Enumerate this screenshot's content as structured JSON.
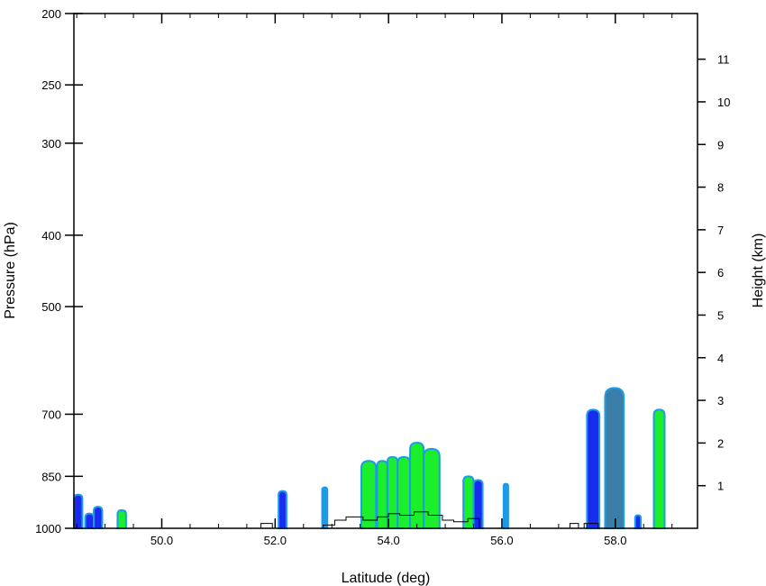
{
  "chart_data": {
    "type": "heatmap",
    "title": "",
    "xlabel": "Latitude (deg)",
    "ylabel": "Pressure (hPa)",
    "y2label": "Height (km)",
    "xlim": [
      48.45,
      59.45
    ],
    "ylim_pressure": [
      1000,
      200
    ],
    "y_scale": "log",
    "x_ticks": [
      50.0,
      52.0,
      54.0,
      56.0,
      58.0
    ],
    "x_tick_labels": [
      "50.0",
      "52.0",
      "54.0",
      "56.0",
      "58.0"
    ],
    "x_minor_step": 0.5,
    "y_ticks": [
      1000,
      850,
      700,
      500,
      400,
      300,
      250,
      200
    ],
    "y_tick_labels": [
      "1000",
      "850",
      "700",
      "500",
      "400",
      "300",
      "250",
      "200"
    ],
    "y2_ticks": [
      1,
      2,
      3,
      4,
      5,
      6,
      7,
      8,
      9,
      10,
      11
    ],
    "y2_tick_labels": [
      "1",
      "2",
      "3",
      "4",
      "5",
      "6",
      "7",
      "8",
      "9",
      "10",
      "11"
    ],
    "grid": false,
    "legend": "none",
    "contour_colors": [
      "#1e9be8",
      "#1a2bf0",
      "#1bee2a",
      "#14a83a",
      "#3a7fa8"
    ],
    "cloud_columns": [
      {
        "lat_min": 48.45,
        "lat_max": 48.6,
        "top_hpa": 900,
        "fill": "#1a2bf0"
      },
      {
        "lat_min": 48.65,
        "lat_max": 48.8,
        "top_hpa": 955,
        "fill": "#1a2bf0"
      },
      {
        "lat_min": 48.8,
        "lat_max": 48.95,
        "top_hpa": 935,
        "fill": "#1a2bf0"
      },
      {
        "lat_min": 49.22,
        "lat_max": 49.37,
        "top_hpa": 945,
        "fill": "#1bee2a"
      },
      {
        "lat_min": 52.06,
        "lat_max": 52.2,
        "top_hpa": 890,
        "fill": "#1a2bf0"
      },
      {
        "lat_min": 52.83,
        "lat_max": 52.92,
        "top_hpa": 880,
        "fill": "#1e9be8"
      },
      {
        "lat_min": 53.52,
        "lat_max": 53.78,
        "top_hpa": 810,
        "fill": "#1bee2a"
      },
      {
        "lat_min": 53.8,
        "lat_max": 53.98,
        "top_hpa": 810,
        "fill": "#1bee2a"
      },
      {
        "lat_min": 53.98,
        "lat_max": 54.16,
        "top_hpa": 800,
        "fill": "#1bee2a"
      },
      {
        "lat_min": 54.16,
        "lat_max": 54.38,
        "top_hpa": 800,
        "fill": "#1bee2a"
      },
      {
        "lat_min": 54.38,
        "lat_max": 54.62,
        "top_hpa": 765,
        "fill": "#1bee2a"
      },
      {
        "lat_min": 54.62,
        "lat_max": 54.9,
        "top_hpa": 780,
        "fill": "#1bee2a"
      },
      {
        "lat_min": 55.32,
        "lat_max": 55.5,
        "top_hpa": 850,
        "fill": "#1bee2a"
      },
      {
        "lat_min": 55.5,
        "lat_max": 55.66,
        "top_hpa": 860,
        "fill": "#1a2bf0"
      },
      {
        "lat_min": 56.03,
        "lat_max": 56.11,
        "top_hpa": 870,
        "fill": "#1e9be8"
      },
      {
        "lat_min": 57.5,
        "lat_max": 57.72,
        "top_hpa": 690,
        "fill": "#1a2bf0"
      },
      {
        "lat_min": 57.82,
        "lat_max": 58.15,
        "top_hpa": 645,
        "fill": "#3a7fa8"
      },
      {
        "lat_min": 58.35,
        "lat_max": 58.45,
        "top_hpa": 960,
        "fill": "#1a2bf0"
      },
      {
        "lat_min": 58.68,
        "lat_max": 58.87,
        "top_hpa": 690,
        "fill": "#1bee2a"
      }
    ],
    "terrain_outline": [
      [
        51.75,
        1000
      ],
      [
        51.75,
        985
      ],
      [
        51.95,
        985
      ],
      [
        51.95,
        1000
      ],
      [
        52.85,
        1000
      ],
      [
        52.85,
        990
      ],
      [
        53.05,
        990
      ],
      [
        53.05,
        975
      ],
      [
        53.25,
        975
      ],
      [
        53.25,
        965
      ],
      [
        53.55,
        965
      ],
      [
        53.55,
        975
      ],
      [
        53.8,
        975
      ],
      [
        53.8,
        965
      ],
      [
        54.0,
        965
      ],
      [
        54.0,
        955
      ],
      [
        54.2,
        955
      ],
      [
        54.2,
        960
      ],
      [
        54.45,
        960
      ],
      [
        54.45,
        950
      ],
      [
        54.7,
        950
      ],
      [
        54.7,
        960
      ],
      [
        54.95,
        960
      ],
      [
        54.95,
        975
      ],
      [
        55.15,
        975
      ],
      [
        55.15,
        980
      ],
      [
        55.4,
        980
      ],
      [
        55.4,
        970
      ],
      [
        55.6,
        970
      ],
      [
        55.6,
        1000
      ],
      [
        57.2,
        1000
      ],
      [
        57.2,
        985
      ],
      [
        57.35,
        985
      ],
      [
        57.35,
        1000
      ],
      [
        57.45,
        1000
      ],
      [
        57.45,
        985
      ],
      [
        57.7,
        985
      ],
      [
        57.7,
        1000
      ]
    ]
  }
}
